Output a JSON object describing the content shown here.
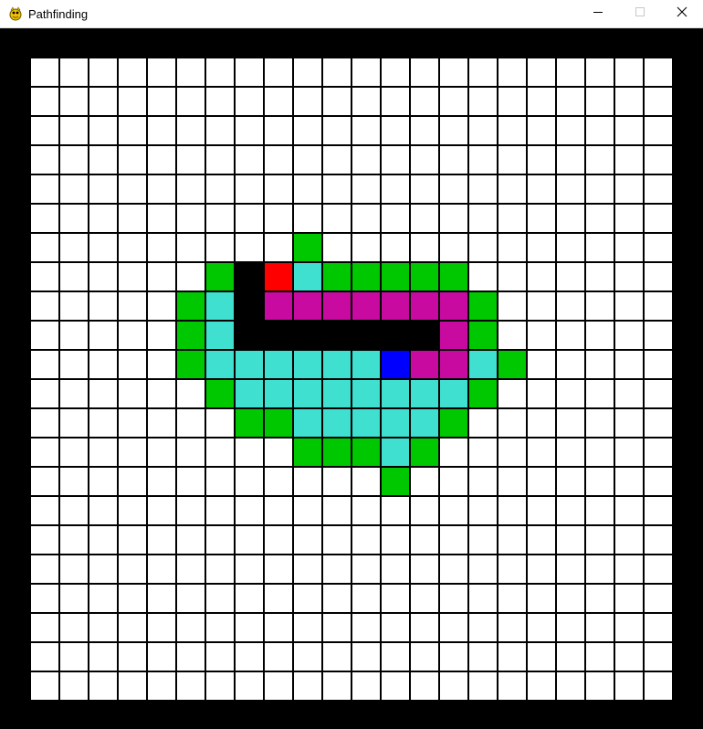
{
  "window": {
    "title": "Pathfinding",
    "app_icon": "pygame-snake-icon",
    "controls": {
      "minimize_icon": "minimize-icon",
      "maximize_icon": "maximize-icon",
      "close_icon": "close-icon"
    }
  },
  "grid": {
    "rows": 22,
    "cols": 22,
    "colors": {
      "empty": "#ffffff",
      "line": "#000000",
      "open": "#00c800",
      "closed": "#40e0d0",
      "path": "#c80aa0",
      "barrier": "#000000",
      "start": "#ff0000",
      "end": "#0000ff"
    },
    "legend": {
      "O": "open",
      "C": "closed",
      "P": "path",
      "X": "barrier",
      "S": "start",
      "E": "end",
      ".": "empty"
    },
    "cells": [
      "......................",
      "......................",
      "......................",
      "......................",
      "......................",
      "......................",
      "....................  ",
      "..........................",
      "......................",
      "......................",
      "......................",
      "......................",
      "......................",
      "......................",
      "......................",
      "......................",
      "......................",
      "......................",
      "......................",
      "......................",
      "......................",
      "......................"
    ],
    "marked_cells": [
      {
        "row": 6,
        "col": 9,
        "state": "open"
      },
      {
        "row": 7,
        "col": 6,
        "state": "open"
      },
      {
        "row": 7,
        "col": 7,
        "state": "barrier"
      },
      {
        "row": 7,
        "col": 8,
        "state": "start"
      },
      {
        "row": 7,
        "col": 9,
        "state": "closed"
      },
      {
        "row": 7,
        "col": 10,
        "state": "open"
      },
      {
        "row": 7,
        "col": 11,
        "state": "open"
      },
      {
        "row": 7,
        "col": 12,
        "state": "open"
      },
      {
        "row": 7,
        "col": 13,
        "state": "open"
      },
      {
        "row": 7,
        "col": 14,
        "state": "open"
      },
      {
        "row": 8,
        "col": 5,
        "state": "open"
      },
      {
        "row": 8,
        "col": 6,
        "state": "closed"
      },
      {
        "row": 8,
        "col": 7,
        "state": "barrier"
      },
      {
        "row": 8,
        "col": 8,
        "state": "path"
      },
      {
        "row": 8,
        "col": 9,
        "state": "path"
      },
      {
        "row": 8,
        "col": 10,
        "state": "path"
      },
      {
        "row": 8,
        "col": 11,
        "state": "path"
      },
      {
        "row": 8,
        "col": 12,
        "state": "path"
      },
      {
        "row": 8,
        "col": 13,
        "state": "path"
      },
      {
        "row": 8,
        "col": 14,
        "state": "path"
      },
      {
        "row": 8,
        "col": 15,
        "state": "open"
      },
      {
        "row": 9,
        "col": 5,
        "state": "open"
      },
      {
        "row": 9,
        "col": 6,
        "state": "closed"
      },
      {
        "row": 9,
        "col": 7,
        "state": "barrier"
      },
      {
        "row": 9,
        "col": 8,
        "state": "barrier"
      },
      {
        "row": 9,
        "col": 9,
        "state": "barrier"
      },
      {
        "row": 9,
        "col": 10,
        "state": "barrier"
      },
      {
        "row": 9,
        "col": 11,
        "state": "barrier"
      },
      {
        "row": 9,
        "col": 12,
        "state": "barrier"
      },
      {
        "row": 9,
        "col": 13,
        "state": "barrier"
      },
      {
        "row": 9,
        "col": 14,
        "state": "path"
      },
      {
        "row": 9,
        "col": 15,
        "state": "open"
      },
      {
        "row": 10,
        "col": 5,
        "state": "open"
      },
      {
        "row": 10,
        "col": 6,
        "state": "closed"
      },
      {
        "row": 10,
        "col": 7,
        "state": "closed"
      },
      {
        "row": 10,
        "col": 8,
        "state": "closed"
      },
      {
        "row": 10,
        "col": 9,
        "state": "closed"
      },
      {
        "row": 10,
        "col": 10,
        "state": "closed"
      },
      {
        "row": 10,
        "col": 11,
        "state": "closed"
      },
      {
        "row": 10,
        "col": 12,
        "state": "end"
      },
      {
        "row": 10,
        "col": 13,
        "state": "path"
      },
      {
        "row": 10,
        "col": 14,
        "state": "path"
      },
      {
        "row": 10,
        "col": 15,
        "state": "closed"
      },
      {
        "row": 10,
        "col": 16,
        "state": "open"
      },
      {
        "row": 11,
        "col": 6,
        "state": "open"
      },
      {
        "row": 11,
        "col": 7,
        "state": "closed"
      },
      {
        "row": 11,
        "col": 8,
        "state": "closed"
      },
      {
        "row": 11,
        "col": 9,
        "state": "closed"
      },
      {
        "row": 11,
        "col": 10,
        "state": "closed"
      },
      {
        "row": 11,
        "col": 11,
        "state": "closed"
      },
      {
        "row": 11,
        "col": 12,
        "state": "closed"
      },
      {
        "row": 11,
        "col": 13,
        "state": "closed"
      },
      {
        "row": 11,
        "col": 14,
        "state": "closed"
      },
      {
        "row": 11,
        "col": 15,
        "state": "open"
      },
      {
        "row": 12,
        "col": 7,
        "state": "open"
      },
      {
        "row": 12,
        "col": 8,
        "state": "open"
      },
      {
        "row": 12,
        "col": 9,
        "state": "closed"
      },
      {
        "row": 12,
        "col": 10,
        "state": "closed"
      },
      {
        "row": 12,
        "col": 11,
        "state": "closed"
      },
      {
        "row": 12,
        "col": 12,
        "state": "closed"
      },
      {
        "row": 12,
        "col": 13,
        "state": "closed"
      },
      {
        "row": 12,
        "col": 14,
        "state": "open"
      },
      {
        "row": 13,
        "col": 9,
        "state": "open"
      },
      {
        "row": 13,
        "col": 10,
        "state": "open"
      },
      {
        "row": 13,
        "col": 11,
        "state": "open"
      },
      {
        "row": 13,
        "col": 12,
        "state": "closed"
      },
      {
        "row": 13,
        "col": 13,
        "state": "open"
      },
      {
        "row": 14,
        "col": 12,
        "state": "open"
      }
    ]
  }
}
